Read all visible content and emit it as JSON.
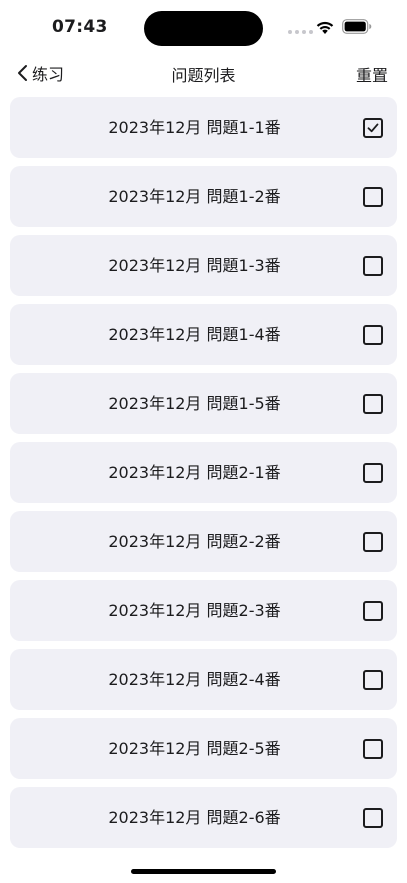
{
  "status_bar": {
    "time": "07:43"
  },
  "nav": {
    "back_label": "练习",
    "title": "问题列表",
    "reset_label": "重置"
  },
  "items": [
    {
      "label": "2023年12月 問題1-1番",
      "checked": true
    },
    {
      "label": "2023年12月 問題1-2番",
      "checked": false
    },
    {
      "label": "2023年12月 問題1-3番",
      "checked": false
    },
    {
      "label": "2023年12月 問題1-4番",
      "checked": false
    },
    {
      "label": "2023年12月 問題1-5番",
      "checked": false
    },
    {
      "label": "2023年12月 問題2-1番",
      "checked": false
    },
    {
      "label": "2023年12月 問題2-2番",
      "checked": false
    },
    {
      "label": "2023年12月 問題2-3番",
      "checked": false
    },
    {
      "label": "2023年12月 問題2-4番",
      "checked": false
    },
    {
      "label": "2023年12月 問題2-5番",
      "checked": false
    },
    {
      "label": "2023年12月 問題2-6番",
      "checked": false
    }
  ],
  "icons": {
    "back": "chevron-left-icon",
    "check": "checkmark-icon",
    "wifi": "wifi-icon",
    "battery": "battery-icon"
  }
}
